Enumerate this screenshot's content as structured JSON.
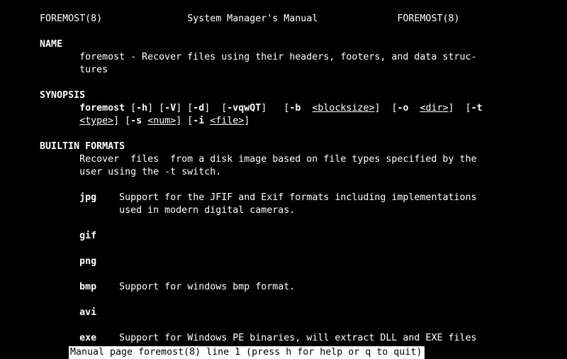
{
  "header": {
    "left": "FOREMOST(8)",
    "center": "System Manager's Manual",
    "right": "FOREMOST(8)"
  },
  "sections": {
    "name": {
      "heading": "NAME",
      "body": "foremost - Recover files using their headers, footers, and data struc-\n              tures"
    },
    "synopsis": {
      "heading": "SYNOPSIS",
      "cmd": "foremost",
      "opts": {
        "h": "-h",
        "V": "-V",
        "d": "-d",
        "vqwQT": "-vqwQT",
        "b": "-b",
        "o": "-o",
        "t": "-t",
        "s": "-s",
        "i": "-i"
      },
      "args": {
        "blocksize": "<blocksize>",
        "dir": "<dir>",
        "type": "<type>",
        "num": "<num>",
        "file": "<file>"
      }
    },
    "builtin": {
      "heading": "BUILTIN FORMATS",
      "intro": "Recover  files  from a disk image based on file types specified by the\n              user using the -t switch.",
      "items": {
        "jpg": {
          "tag": "jpg",
          "desc": "Support for the JFIF and Exif formats including implementations\n                     used in modern digital cameras."
        },
        "gif": {
          "tag": "gif",
          "desc": ""
        },
        "png": {
          "tag": "png",
          "desc": ""
        },
        "bmp": {
          "tag": "bmp",
          "desc": "Support for windows bmp format."
        },
        "avi": {
          "tag": "avi",
          "desc": ""
        },
        "exe": {
          "tag": "exe",
          "desc": "Support for Windows PE binaries, will extract DLL and EXE files\n                     along with their compile times."
        }
      }
    }
  },
  "status": " Manual page foremost(8) line 1 (press h for help or q to quit)"
}
